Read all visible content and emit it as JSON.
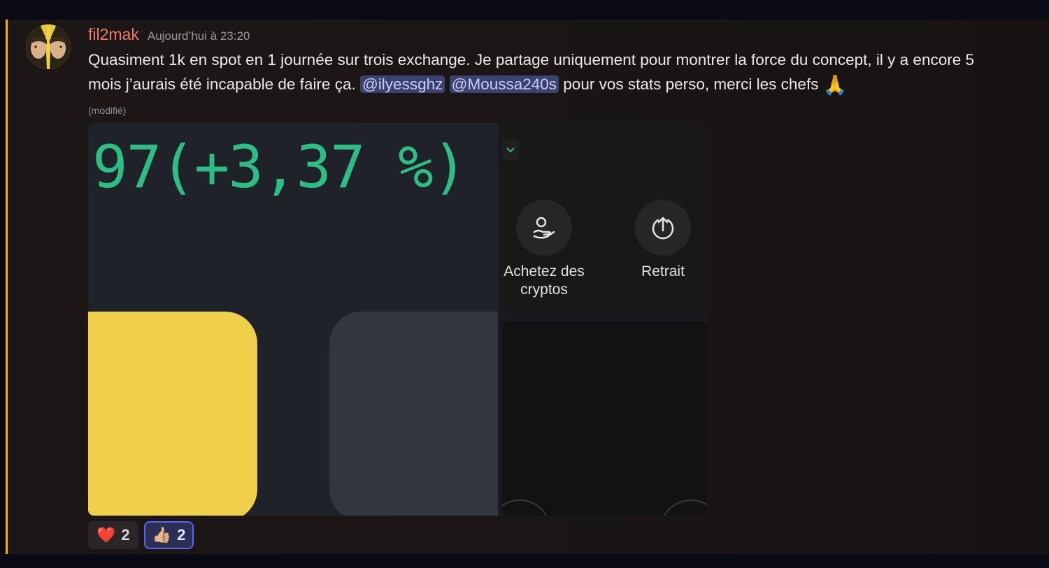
{
  "message": {
    "username": "fil2mak",
    "timestamp": "Aujourd’hui à 23:20",
    "content_part1": "Quasiment 1k en spot en 1 journée sur trois exchange. Je partage uniquement pour montrer la force du concept, il y a encore 5 mois j’aurais été incapable de faire ça. ",
    "mention1": "@ilyessghz",
    "mention2": "@Moussa240s",
    "content_part2": " pour vos stats perso, merci les chefs ",
    "emoji": "🙏",
    "edited_label": "(modifié)"
  },
  "attachment": {
    "percent_text": "97(+3,37 %)",
    "actions": [
      {
        "label": "Achetez des cryptos",
        "icon": "hand-coin-icon"
      },
      {
        "label": "Retrait",
        "icon": "upload-arrow-icon"
      }
    ]
  },
  "reactions": [
    {
      "emoji": "❤️",
      "count": "2",
      "active": false
    },
    {
      "emoji": "👍🏼",
      "count": "2",
      "active": true
    }
  ],
  "colors": {
    "username": "#f47b67",
    "mention_bg": "#3c4270",
    "percent_green": "#2ebd85",
    "yellow_card": "#f0d04a",
    "active_reaction_border": "#5865f2"
  }
}
